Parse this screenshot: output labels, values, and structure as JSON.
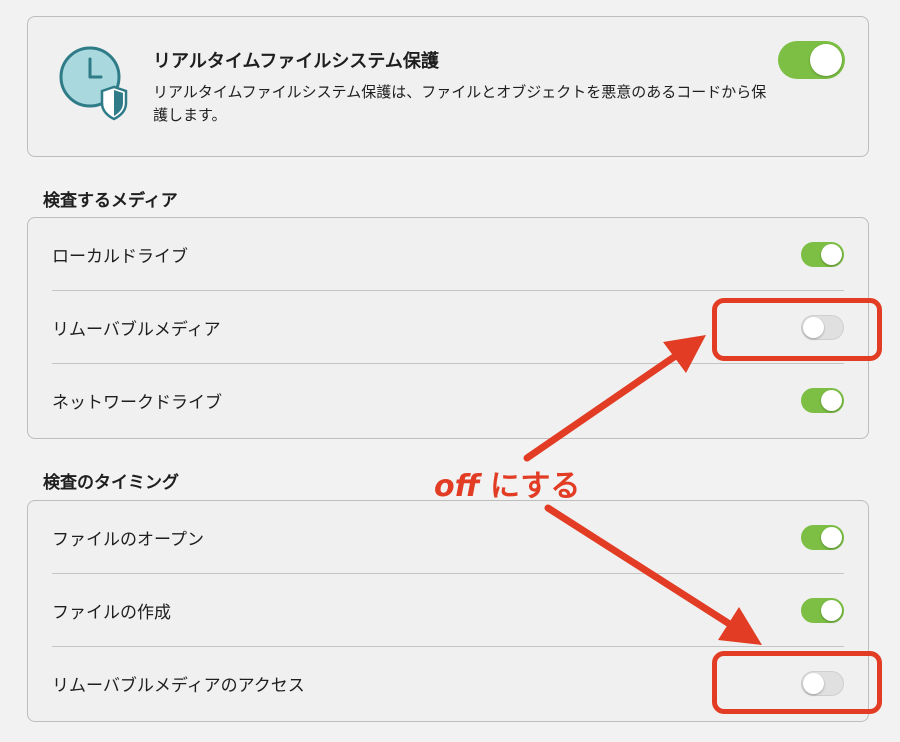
{
  "realtime": {
    "title": "リアルタイムファイルシステム保護",
    "description": "リアルタイムファイルシステム保護は、ファイルとオブジェクトを悪意のあるコードから保護します。",
    "enabled": true,
    "icon": "clock-shield-icon"
  },
  "media": {
    "title": "検査するメディア",
    "items": [
      {
        "label": "ローカルドライブ",
        "enabled": true
      },
      {
        "label": "リムーバブルメディア",
        "enabled": false
      },
      {
        "label": "ネットワークドライブ",
        "enabled": true
      }
    ]
  },
  "timing": {
    "title": "検査のタイミング",
    "items": [
      {
        "label": "ファイルのオープン",
        "enabled": true
      },
      {
        "label": "ファイルの作成",
        "enabled": true
      },
      {
        "label": "リムーバブルメディアのアクセス",
        "enabled": false
      }
    ]
  },
  "annotation": {
    "text_em": "off",
    "text_rest": " にする",
    "color": "#e23d24"
  },
  "colors": {
    "toggle_on": "#7cbf44",
    "toggle_off": "#e0e0e0",
    "icon_fill": "#a9d8de",
    "icon_stroke": "#2f7c88"
  }
}
